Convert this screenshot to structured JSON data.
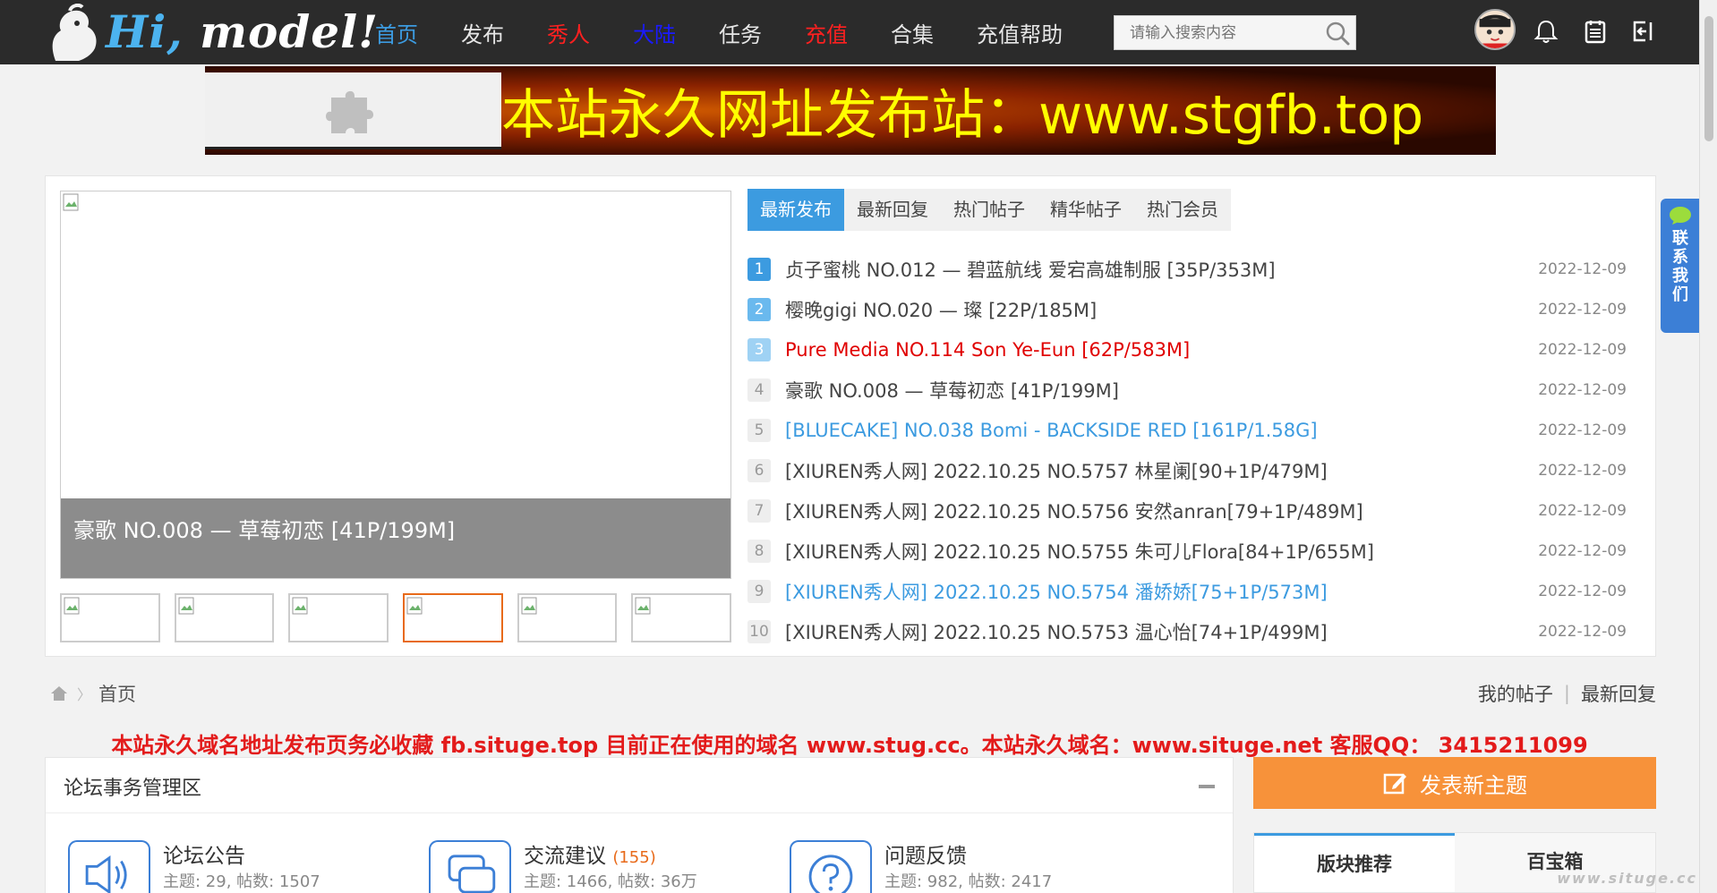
{
  "header": {
    "logo_text_hi": "Hi,",
    "logo_text_model": "model!",
    "nav": [
      {
        "label": "首页",
        "color": "#3c9be0"
      },
      {
        "label": "发布",
        "color": "#e6e6e6"
      },
      {
        "label": "秀人",
        "color": "#ff2020"
      },
      {
        "label": "大陆",
        "color": "#1a1aff"
      },
      {
        "label": "任务",
        "color": "#e6e6e6"
      },
      {
        "label": "充值",
        "color": "#ff2020"
      },
      {
        "label": "合集",
        "color": "#e6e6e6"
      },
      {
        "label": "充值帮助",
        "color": "#e6e6e6"
      }
    ],
    "search_placeholder": "请输入搜索内容"
  },
  "banner": {
    "text": "本站永久网址发布站：www.stgfb.top"
  },
  "slideshow": {
    "caption": "豪歌 NO.008 — 草莓初恋 [41P/199M]",
    "thumbnail_count": 6,
    "active_thumbnail": 4
  },
  "tabs": [
    "最新发布",
    "最新回复",
    "热门帖子",
    "精华帖子",
    "热门会员"
  ],
  "active_tab": 0,
  "posts": [
    {
      "num": "1",
      "title": "贞子蜜桃 NO.012 — 碧蓝航线 爱宕高雄制服 [35P/353M]",
      "date": "2022-12-09",
      "style": "normal",
      "rank": "top"
    },
    {
      "num": "2",
      "title": "樱晚gigi NO.020 — 璨 [22P/185M]",
      "date": "2022-12-09",
      "style": "normal",
      "rank": "mid"
    },
    {
      "num": "3",
      "title": "Pure Media NO.114 Son Ye-Eun [62P/583M]",
      "date": "2022-12-09",
      "style": "red",
      "rank": "low"
    },
    {
      "num": "4",
      "title": "豪歌 NO.008 — 草莓初恋 [41P/199M]",
      "date": "2022-12-09",
      "style": "normal",
      "rank": "plain"
    },
    {
      "num": "5",
      "title": "[BLUECAKE] NO.038 Bomi - BACKSIDE RED [161P/1.58G]",
      "date": "2022-12-09",
      "style": "blue",
      "rank": "plain"
    },
    {
      "num": "6",
      "title": "[XIUREN秀人网] 2022.10.25 NO.5757 林星阑[90+1P/479M]",
      "date": "2022-12-09",
      "style": "normal",
      "rank": "plain"
    },
    {
      "num": "7",
      "title": "[XIUREN秀人网] 2022.10.25 NO.5756 安然anran[79+1P/489M]",
      "date": "2022-12-09",
      "style": "normal",
      "rank": "plain"
    },
    {
      "num": "8",
      "title": "[XIUREN秀人网] 2022.10.25 NO.5755 朱可儿Flora[84+1P/655M]",
      "date": "2022-12-09",
      "style": "normal",
      "rank": "plain"
    },
    {
      "num": "9",
      "title": "[XIUREN秀人网] 2022.10.25 NO.5754 潘娇娇[75+1P/573M]",
      "date": "2022-12-09",
      "style": "blue",
      "rank": "plain"
    },
    {
      "num": "10",
      "title": "[XIUREN秀人网] 2022.10.25 NO.5753 温心怡[74+1P/499M]",
      "date": "2022-12-09",
      "style": "normal",
      "rank": "plain"
    }
  ],
  "breadcrumb": {
    "home": "首页",
    "my_posts": "我的帖子",
    "latest_replies": "最新回复"
  },
  "notice": "本站永久域名地址发布页务必收藏 fb.situge.top 目前正在使用的域名 www.stug.cc。本站永久域名：www.situge.net 客服QQ： 3415211099",
  "forum": {
    "section_title": "论坛事务管理区",
    "boards": [
      {
        "name": "论坛公告",
        "count": "",
        "stats": "主题: 29, 帖数: 1507",
        "icon": "speaker-icon"
      },
      {
        "name": "交流建议",
        "count": "(155)",
        "stats": "主题: 1466, 帖数: 36万",
        "icon": "chat-icon"
      },
      {
        "name": "问题反馈",
        "count": "",
        "stats": "主题: 982, 帖数: 2417",
        "icon": "question-icon"
      }
    ]
  },
  "sidebar": {
    "new_topic_label": "发表新主题",
    "tabs": [
      "版块推荐",
      "百宝箱"
    ]
  },
  "contact": {
    "label": "联系我们"
  },
  "watermark": "www.situge.cc",
  "colors": {
    "accent": "#3c9be0",
    "topbar": "#2b2b2b",
    "orange": "#f7923a",
    "red": "#e31b1b"
  }
}
